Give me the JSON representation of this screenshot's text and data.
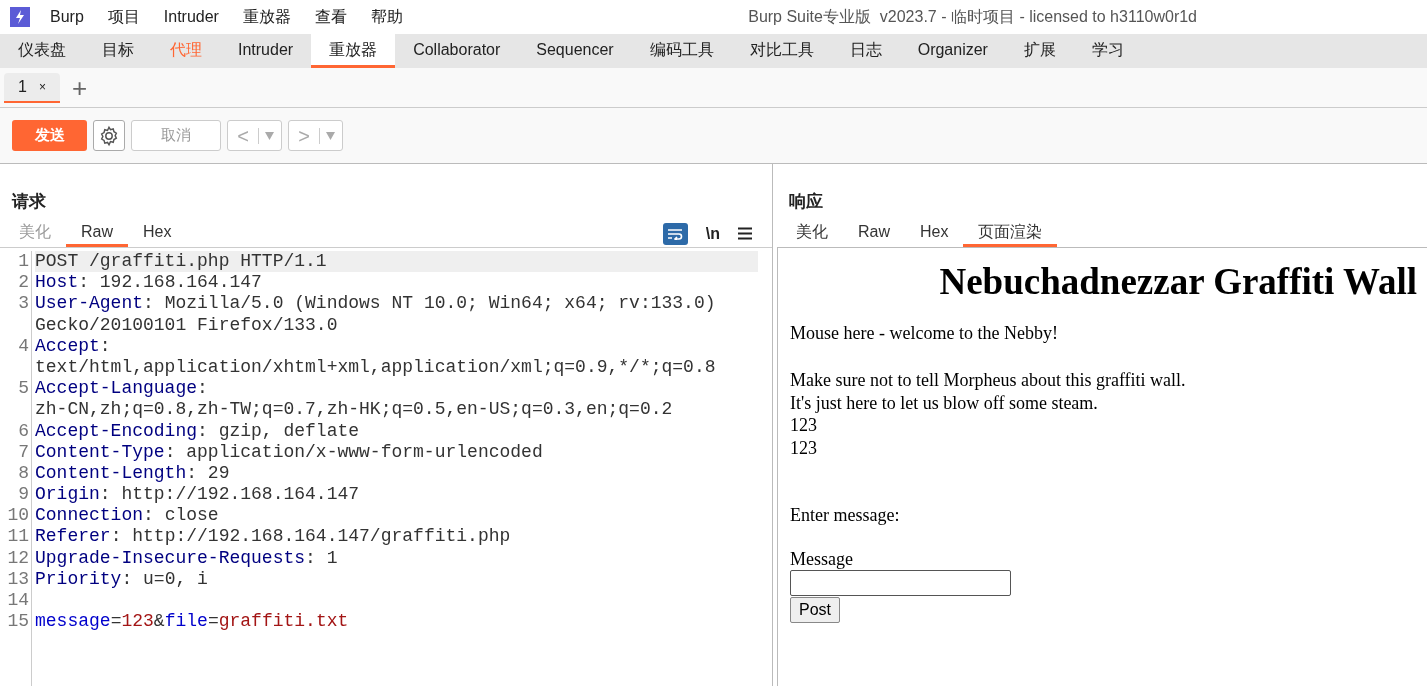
{
  "menubar": {
    "items": [
      "Burp",
      "项目",
      "Intruder",
      "重放器",
      "查看",
      "帮助"
    ],
    "title": "Burp Suite专业版  v2023.7 - 临时项目 - licensed to h3110w0r1d"
  },
  "main_tabs": [
    {
      "label": "仪表盘",
      "selected": false,
      "highlighted": false
    },
    {
      "label": "目标",
      "selected": false,
      "highlighted": false
    },
    {
      "label": "代理",
      "selected": false,
      "highlighted": true
    },
    {
      "label": "Intruder",
      "selected": false,
      "highlighted": false
    },
    {
      "label": "重放器",
      "selected": true,
      "highlighted": false
    },
    {
      "label": "Collaborator",
      "selected": false,
      "highlighted": false
    },
    {
      "label": "Sequencer",
      "selected": false,
      "highlighted": false
    },
    {
      "label": "编码工具",
      "selected": false,
      "highlighted": false
    },
    {
      "label": "对比工具",
      "selected": false,
      "highlighted": false
    },
    {
      "label": "日志",
      "selected": false,
      "highlighted": false
    },
    {
      "label": "Organizer",
      "selected": false,
      "highlighted": false
    },
    {
      "label": "扩展",
      "selected": false,
      "highlighted": false
    },
    {
      "label": "学习",
      "selected": false,
      "highlighted": false
    }
  ],
  "repeater_tabs": [
    {
      "label": "1",
      "close": "×",
      "selected": true
    }
  ],
  "add_tab": "+",
  "toolbar": {
    "send": "发送",
    "cancel": "取消",
    "cancel_disabled": true,
    "back": "<",
    "forward": ">"
  },
  "request": {
    "title": "请求",
    "tabs": [
      {
        "label": "美化",
        "selected": false,
        "disabled": true
      },
      {
        "label": "Raw",
        "selected": true,
        "disabled": false
      },
      {
        "label": "Hex",
        "selected": false,
        "disabled": false
      }
    ],
    "newline_toggle": "\\n",
    "wrap_on": true,
    "lines": [
      {
        "number": "1",
        "selected": true,
        "rows": [
          [
            {
              "text": "POST /graffiti.php HTTP/1.1",
              "kind": "plain"
            }
          ]
        ]
      },
      {
        "number": "2",
        "selected": false,
        "rows": [
          [
            {
              "text": "Host",
              "kind": "header"
            },
            {
              "text": ": 192.168.164.147",
              "kind": "plain"
            }
          ]
        ]
      },
      {
        "number": "3",
        "selected": false,
        "rows": [
          [
            {
              "text": "User-Agent",
              "kind": "header"
            },
            {
              "text": ": Mozilla/5.0 (Windows NT 10.0; Win64; x64; rv:133.0)",
              "kind": "plain"
            }
          ],
          [
            {
              "text": "Gecko/20100101 Firefox/133.0",
              "kind": "plain"
            }
          ]
        ]
      },
      {
        "number": "4",
        "selected": false,
        "rows": [
          [
            {
              "text": "Accept",
              "kind": "header"
            },
            {
              "text": ":",
              "kind": "plain"
            }
          ],
          [
            {
              "text": "text/html,application/xhtml+xml,application/xml;q=0.9,*/*;q=0.8",
              "kind": "plain"
            }
          ]
        ]
      },
      {
        "number": "5",
        "selected": false,
        "rows": [
          [
            {
              "text": "Accept-Language",
              "kind": "header"
            },
            {
              "text": ":",
              "kind": "plain"
            }
          ],
          [
            {
              "text": "zh-CN,zh;q=0.8,zh-TW;q=0.7,zh-HK;q=0.5,en-US;q=0.3,en;q=0.2",
              "kind": "plain"
            }
          ]
        ]
      },
      {
        "number": "6",
        "selected": false,
        "rows": [
          [
            {
              "text": "Accept-Encoding",
              "kind": "header"
            },
            {
              "text": ": gzip, deflate",
              "kind": "plain"
            }
          ]
        ]
      },
      {
        "number": "7",
        "selected": false,
        "rows": [
          [
            {
              "text": "Content-Type",
              "kind": "header"
            },
            {
              "text": ": application/x-www-form-urlencoded",
              "kind": "plain"
            }
          ]
        ]
      },
      {
        "number": "8",
        "selected": false,
        "rows": [
          [
            {
              "text": "Content-Length",
              "kind": "header"
            },
            {
              "text": ": 29",
              "kind": "plain"
            }
          ]
        ]
      },
      {
        "number": "9",
        "selected": false,
        "rows": [
          [
            {
              "text": "Origin",
              "kind": "header"
            },
            {
              "text": ": http://192.168.164.147",
              "kind": "plain"
            }
          ]
        ]
      },
      {
        "number": "10",
        "selected": false,
        "rows": [
          [
            {
              "text": "Connection",
              "kind": "header"
            },
            {
              "text": ": close",
              "kind": "plain"
            }
          ]
        ]
      },
      {
        "number": "11",
        "selected": false,
        "rows": [
          [
            {
              "text": "Referer",
              "kind": "header"
            },
            {
              "text": ": http://192.168.164.147/graffiti.php",
              "kind": "plain"
            }
          ]
        ]
      },
      {
        "number": "12",
        "selected": false,
        "rows": [
          [
            {
              "text": "Upgrade-Insecure-Requests",
              "kind": "header"
            },
            {
              "text": ": 1",
              "kind": "plain"
            }
          ]
        ]
      },
      {
        "number": "13",
        "selected": false,
        "rows": [
          [
            {
              "text": "Priority",
              "kind": "header"
            },
            {
              "text": ": u=0, i",
              "kind": "plain"
            }
          ]
        ]
      },
      {
        "number": "14",
        "selected": false,
        "rows": [
          []
        ]
      },
      {
        "number": "15",
        "selected": false,
        "rows": [
          [
            {
              "text": "message",
              "kind": "param"
            },
            {
              "text": "=",
              "kind": "plain"
            },
            {
              "text": "123",
              "kind": "value"
            },
            {
              "text": "&",
              "kind": "plain"
            },
            {
              "text": "file",
              "kind": "param"
            },
            {
              "text": "=",
              "kind": "plain"
            },
            {
              "text": "graffiti.txt",
              "kind": "value"
            }
          ]
        ]
      }
    ]
  },
  "response": {
    "title": "响应",
    "tabs": [
      {
        "label": "美化",
        "selected": false,
        "disabled": false
      },
      {
        "label": "Raw",
        "selected": false,
        "disabled": false
      },
      {
        "label": "Hex",
        "selected": false,
        "disabled": false
      },
      {
        "label": "页面渲染",
        "selected": true,
        "disabled": false
      }
    ],
    "render": {
      "heading": "Nebuchadnezzar Graffiti Wall",
      "intro": "Mouse here - welcome to the Nebby!",
      "paragraph_lines": [
        "Make sure not to tell Morpheus about this graffiti wall.",
        "It's just here to let us blow off some steam.",
        "123",
        "123"
      ],
      "prompt": "Enter message:",
      "field_label": "Message",
      "submit": "Post"
    }
  }
}
